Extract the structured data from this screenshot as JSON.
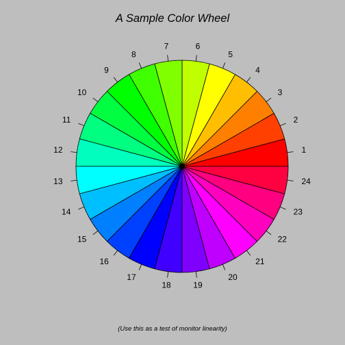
{
  "chart_data": {
    "type": "pie",
    "title": "A Sample Color Wheel",
    "subtitle": "(Use this as a test of monitor linearity)",
    "labels": [
      "1",
      "2",
      "3",
      "4",
      "5",
      "6",
      "7",
      "8",
      "9",
      "10",
      "11",
      "12",
      "13",
      "14",
      "15",
      "16",
      "17",
      "18",
      "19",
      "20",
      "21",
      "22",
      "23",
      "24"
    ],
    "values": [
      1,
      1,
      1,
      1,
      1,
      1,
      1,
      1,
      1,
      1,
      1,
      1,
      1,
      1,
      1,
      1,
      1,
      1,
      1,
      1,
      1,
      1,
      1,
      1
    ],
    "colors": [
      "#FF0000",
      "#FF4000",
      "#FF8000",
      "#FFBF00",
      "#FFFF00",
      "#BFFF00",
      "#80FF00",
      "#40FF00",
      "#00FF00",
      "#00FF40",
      "#00FF80",
      "#00FFBF",
      "#00FFFF",
      "#00BFFF",
      "#0080FF",
      "#0040FF",
      "#0000FF",
      "#4000FF",
      "#8000FF",
      "#BF00FF",
      "#FF00FF",
      "#FF00BF",
      "#FF0080",
      "#FF0040"
    ],
    "direction": "counterclockwise",
    "legend": "none",
    "grid": false
  },
  "background_color": "#BEBEBE"
}
